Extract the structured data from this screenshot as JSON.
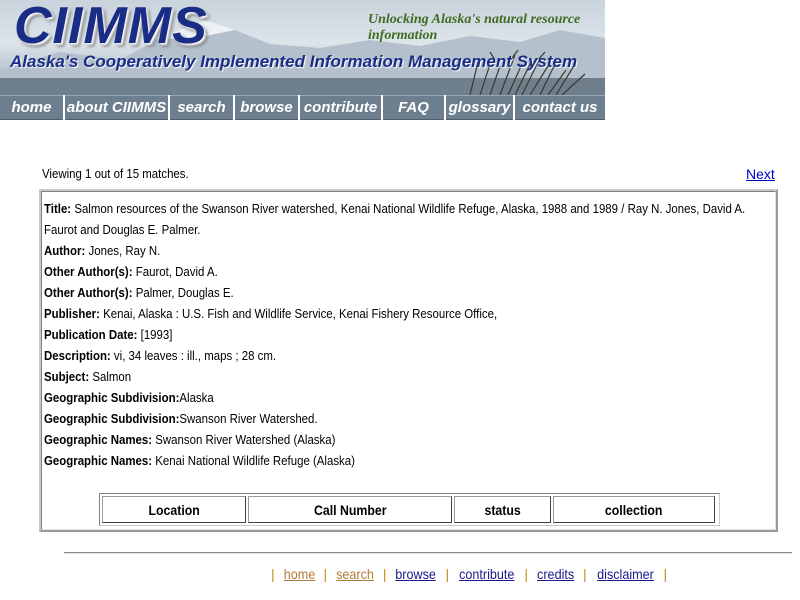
{
  "banner": {
    "logo": "CIIMMS",
    "tagline": "Unlocking Alaska's natural resource information",
    "subtitle": "Alaska's Cooperatively Implemented Information Management System"
  },
  "nav": [
    {
      "label": "home"
    },
    {
      "label": "about CIIMMS"
    },
    {
      "label": "search"
    },
    {
      "label": "browse"
    },
    {
      "label": "contribute"
    },
    {
      "label": "FAQ"
    },
    {
      "label": "glossary"
    },
    {
      "label": "contact us"
    }
  ],
  "results": {
    "viewing": "Viewing 1 out of 15 matches.",
    "next": "Next"
  },
  "record": {
    "title_label": "Title:",
    "title_value": "Salmon resources of the Swanson River watershed, Kenai National Wildlife Refuge, Alaska, 1988 and 1989 / Ray N. Jones, David A. Faurot and Douglas E. Palmer.",
    "author_label": "Author:",
    "author_value": "Jones, Ray N.",
    "other_author_label": "Other Author(s):",
    "other_author_1": "Faurot, David A.",
    "other_author_2": "Palmer, Douglas E.",
    "publisher_label": "Publisher:",
    "publisher_value": "Kenai, Alaska : U.S. Fish and Wildlife Service, Kenai Fishery Resource Office,",
    "pubdate_label": "Publication Date:",
    "pubdate_value": "[1993]",
    "description_label": "Description:",
    "description_value": "vi, 34 leaves : ill., maps ; 28 cm.",
    "subject_label": "Subject:",
    "subject_value": "Salmon",
    "geo_sub_label": "Geographic Subdivision:",
    "geo_sub_1": "Alaska",
    "geo_sub_2": "Swanson River Watershed.",
    "geo_names_label": "Geographic Names:",
    "geo_names_1": "Swanson River Watershed (Alaska)",
    "geo_names_2": "Kenai National Wildlife Refuge (Alaska)"
  },
  "holdings": {
    "columns": [
      "Location",
      "Call Number",
      "status",
      "collection"
    ]
  },
  "footer": {
    "links": [
      "home",
      "search",
      "browse",
      "contribute",
      "credits",
      "disclaimer"
    ],
    "separator": "|"
  }
}
